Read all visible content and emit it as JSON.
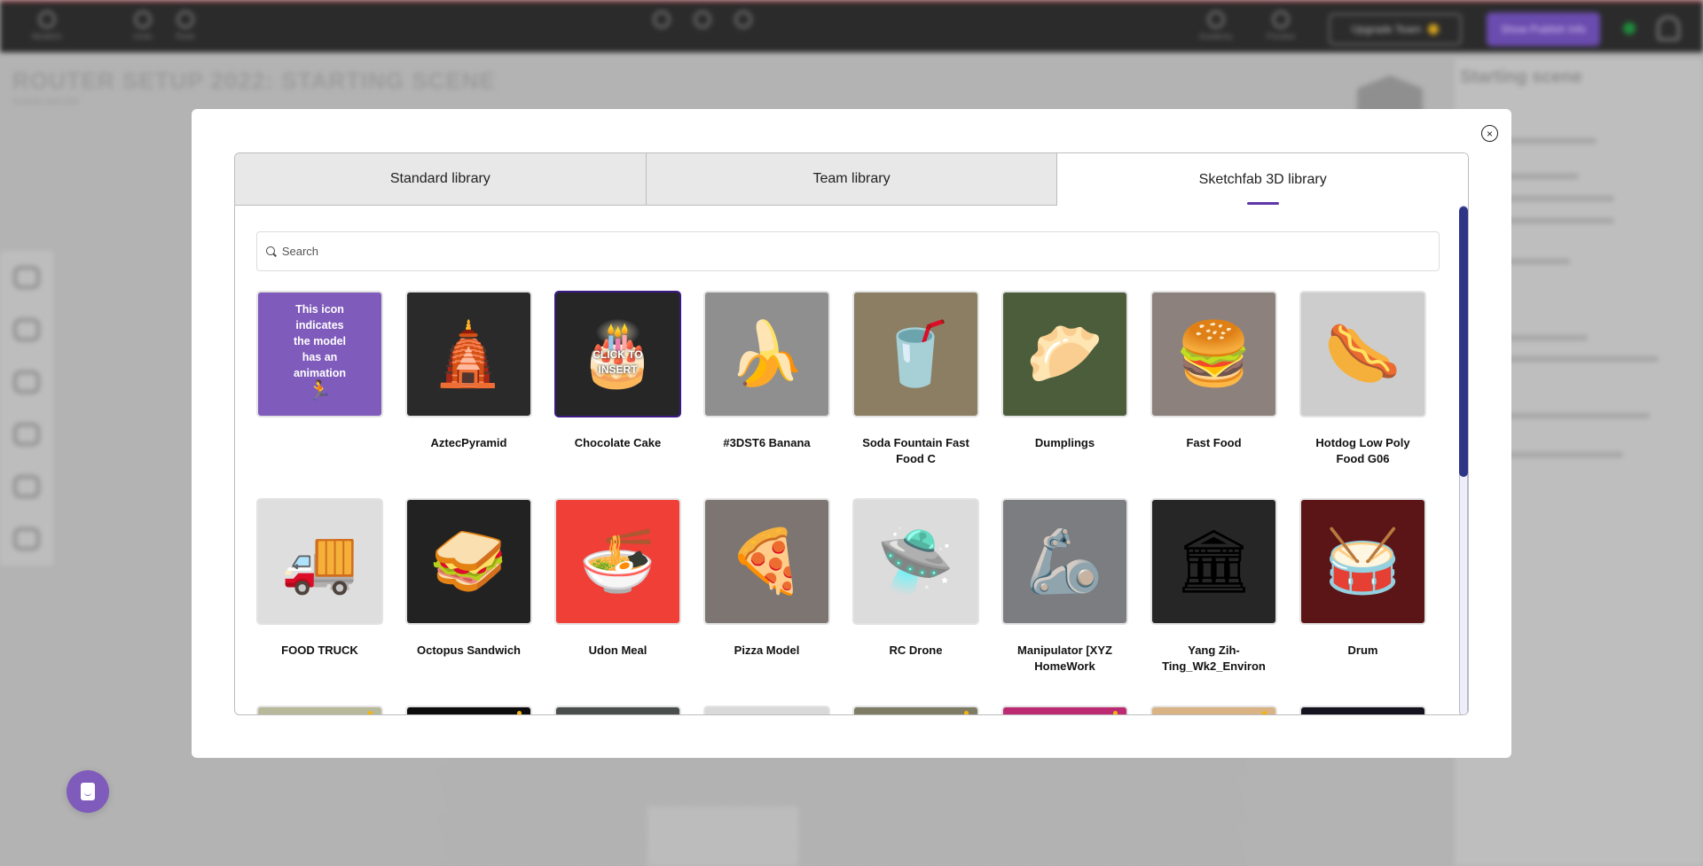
{
  "app": {
    "topbar": {
      "logo_label": "Modelrix",
      "undo_label": "Undo",
      "redo_label": "Redo",
      "academy_label": "Academy",
      "preview_label": "Preview",
      "upgrade_label": "Upgrade Team",
      "publish_label": "Show Publish Info"
    },
    "page_title": "ROUTER SETUP 2022: STARTING SCENE",
    "page_subtitle": "SCENE EDITOR",
    "right_panel": {
      "title": "Starting scene"
    },
    "colors": {
      "accent": "#5f36a7",
      "scrollbar": "#2e3486",
      "animation_badge": "#f5b40d",
      "chat_button": "#7f5bbb",
      "status_online": "#1e8a3b"
    }
  },
  "modal": {
    "close_symbol": "×",
    "tabs": [
      {
        "label": "Standard library",
        "active": false
      },
      {
        "label": "Team library",
        "active": false
      },
      {
        "label": "Sketchfab 3D library",
        "active": true
      }
    ],
    "search": {
      "value": "",
      "placeholder": "Search"
    },
    "animation_info": {
      "lines": [
        "This icon",
        "indicates",
        "the model",
        "has an",
        "animation"
      ],
      "icon": "running-person"
    },
    "hover_label": "CLICK TO INSERT",
    "scroll_fraction": 0.53,
    "models": [
      {
        "name": "AztecPyramid",
        "bg": "#2a2a2a",
        "emoji": "🛕"
      },
      {
        "name": "Chocolate Cake",
        "bg": "#262626",
        "emoji": "🎂",
        "hovered": true
      },
      {
        "name": "#3DST6 Banana",
        "bg": "#8f8f8f",
        "emoji": "🍌"
      },
      {
        "name": "Soda Fountain Fast Food C",
        "bg": "#8b7e62",
        "emoji": "🥤"
      },
      {
        "name": "Dumplings",
        "bg": "#4c5d3b",
        "emoji": "🥟"
      },
      {
        "name": "Fast Food",
        "bg": "#8d817e",
        "emoji": "🍔"
      },
      {
        "name": "Hotdog Low Poly Food G06",
        "bg": "#cdcdcd",
        "emoji": "🌭"
      },
      {
        "name": "FOOD TRUCK",
        "bg": "#dedede",
        "emoji": "🚚"
      },
      {
        "name": "Octopus Sandwich",
        "bg": "#222222",
        "emoji": "🥪"
      },
      {
        "name": "Udon Meal",
        "bg": "#ef3f37",
        "emoji": "🍜"
      },
      {
        "name": "Pizza Model",
        "bg": "#7d7572",
        "emoji": "🍕"
      },
      {
        "name": "RC Drone",
        "bg": "#dcdcdc",
        "emoji": "🛸"
      },
      {
        "name": "Manipulator [XYZ HomeWork",
        "bg": "#7b7d80",
        "emoji": "🦾"
      },
      {
        "name": "Yang Zih-Ting_Wk2_Environ",
        "bg": "#262626",
        "emoji": "🏛"
      },
      {
        "name": "Drum",
        "bg": "#5b1517",
        "emoji": "🥁"
      }
    ],
    "partial_row": [
      {
        "bg": "#b8b89a",
        "animated": true
      },
      {
        "bg": "#0c0c0c",
        "animated": true
      },
      {
        "bg": "#4a4e4c",
        "animated": false
      },
      {
        "bg": "#d9d9d9",
        "animated": false
      },
      {
        "bg": "#7f7c66",
        "animated": true
      },
      {
        "bg": "#bc2a72",
        "animated": true
      },
      {
        "bg": "#d9b384",
        "animated": true
      },
      {
        "bg": "#15131f",
        "animated": false
      }
    ]
  }
}
